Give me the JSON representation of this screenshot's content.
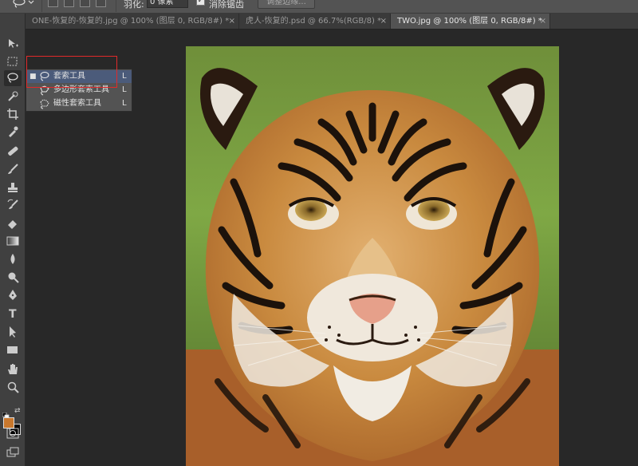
{
  "options_bar": {
    "feather_label": "羽化:",
    "feather_value": "0 像素",
    "anti_alias_label": "消除锯齿",
    "anti_alias_checked": "✓",
    "refine_edge_label": "调整边缘..."
  },
  "tabs": [
    {
      "label": "ONE-恢复的-恢复的.jpg @ 100% (图层 0, RGB/8#) *",
      "close": "×"
    },
    {
      "label": "虎人-恢复的.psd @ 66.7%(RGB/8) *",
      "close": "×"
    },
    {
      "label": "TWO.jpg @ 100% (图层 0, RGB/8#) *",
      "close": "×"
    }
  ],
  "flyout": {
    "items": [
      {
        "label": "套索工具",
        "shortcut": "L",
        "bullet": "■"
      },
      {
        "label": "多边形套索工具",
        "shortcut": "L",
        "bullet": ""
      },
      {
        "label": "磁性套索工具",
        "shortcut": "L",
        "bullet": ""
      }
    ]
  },
  "colors": {
    "foreground": "#c9782d",
    "background": "#000000",
    "highlight": "#e02a2a"
  },
  "tools": [
    "move-icon",
    "marquee-icon",
    "lasso-icon",
    "quick-select-icon",
    "crop-icon",
    "eyedropper-icon",
    "healing-icon",
    "brush-icon",
    "stamp-icon",
    "history-brush-icon",
    "eraser-icon",
    "gradient-icon",
    "blur-icon",
    "dodge-icon",
    "pen-icon",
    "type-icon",
    "path-select-icon",
    "shape-icon",
    "hand-icon",
    "zoom-icon",
    "quickmask-icon",
    "screen-mode-icon"
  ],
  "type_tool_glyph": "T"
}
